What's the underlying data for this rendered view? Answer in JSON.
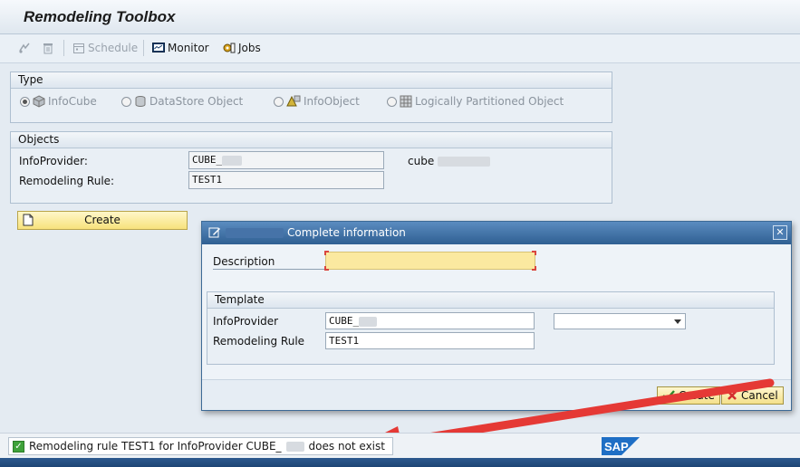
{
  "window": {
    "title": "Remodeling Toolbox"
  },
  "toolbar": {
    "schedule_label": "Schedule",
    "monitor_label": "Monitor",
    "jobs_label": "Jobs"
  },
  "type_group": {
    "title": "Type",
    "options": [
      {
        "label": "InfoCube",
        "selected": true
      },
      {
        "label": "DataStore Object",
        "selected": false
      },
      {
        "label": "InfoObject",
        "selected": false
      },
      {
        "label": "Logically Partitioned Object",
        "selected": false
      }
    ]
  },
  "objects_group": {
    "title": "Objects",
    "infoprovider_label": "InfoProvider:",
    "infoprovider_value": "CUBE_",
    "infoprovider_desc": "cube",
    "rule_label": "Remodeling Rule:",
    "rule_value": "TEST1"
  },
  "create_button": {
    "label": "Create"
  },
  "dialog": {
    "title": "Complete information",
    "description_label": "Description",
    "description_value": "",
    "template_title": "Template",
    "infoprovider_label": "InfoProvider",
    "infoprovider_value": "CUBE_",
    "rule_label": "Remodeling Rule",
    "rule_value": "TEST1",
    "create_label": "Create",
    "cancel_label": "Cancel"
  },
  "status": {
    "message": "Remodeling rule TEST1 for InfoProvider CUBE_",
    "message_tail": "does not exist",
    "color": "#3fa23a"
  },
  "brand": {
    "logo_text": "SAP",
    "color": "#1f6fc5"
  },
  "annotation": {
    "arrow_color": "#e53935"
  }
}
